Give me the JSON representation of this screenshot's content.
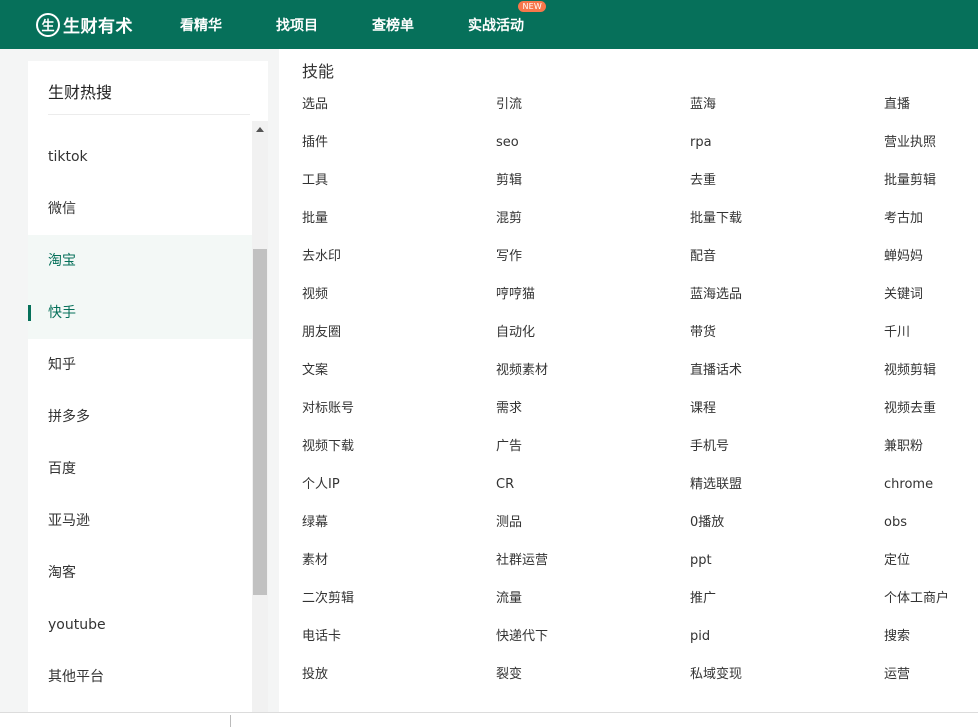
{
  "header": {
    "logo_mark": "生",
    "logo_text": "生财有术",
    "nav": [
      {
        "label": "看精华"
      },
      {
        "label": "找项目"
      },
      {
        "label": "查榜单"
      },
      {
        "label": "实战活动",
        "badge": "NEW"
      }
    ]
  },
  "sidebar": {
    "title": "生财热搜",
    "items": [
      {
        "label": "tiktok"
      },
      {
        "label": "微信"
      },
      {
        "label": "淘宝"
      },
      {
        "label": "快手"
      },
      {
        "label": "知乎"
      },
      {
        "label": "拼多多"
      },
      {
        "label": "百度"
      },
      {
        "label": "亚马逊"
      },
      {
        "label": "淘客"
      },
      {
        "label": "youtube"
      },
      {
        "label": "其他平台"
      }
    ],
    "active_index": 3,
    "hover_index": 2
  },
  "main": {
    "section_title": "技能",
    "tags": [
      "选品",
      "引流",
      "蓝海",
      "直播",
      "插件",
      "seo",
      "rpa",
      "营业执照",
      "工具",
      "剪辑",
      "去重",
      "批量剪辑",
      "批量",
      "混剪",
      "批量下载",
      "考古加",
      "去水印",
      "写作",
      "配音",
      "蝉妈妈",
      "视频",
      "哼哼猫",
      "蓝海选品",
      "关键词",
      "朋友圈",
      "自动化",
      "带货",
      "千川",
      "文案",
      "视频素材",
      "直播话术",
      "视频剪辑",
      "对标账号",
      "需求",
      "课程",
      "视频去重",
      "视频下载",
      "广告",
      "手机号",
      "兼职粉",
      "个人IP",
      "CR",
      "精选联盟",
      "chrome",
      "绿幕",
      "测品",
      "0播放",
      "obs",
      "素材",
      "社群运营",
      "ppt",
      "定位",
      "二次剪辑",
      "流量",
      "推广",
      "个体工商户",
      "电话卡",
      "快递代下",
      "pid",
      "搜索",
      "投放",
      "裂变",
      "私域变现",
      "运营"
    ]
  },
  "colors": {
    "brand": "#06705a",
    "badge": "#f7774b"
  }
}
